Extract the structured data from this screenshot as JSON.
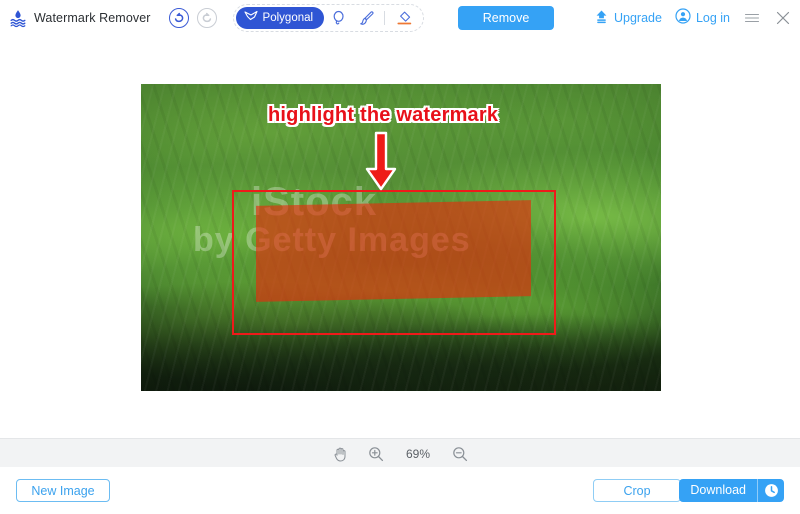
{
  "header": {
    "brand_title": "Watermark Remover",
    "logo_icon": "watermark-droplet-icon",
    "undo_icon": "undo-arrow-icon",
    "redo_icon": "redo-arrow-icon",
    "tools": {
      "active_label": "Polygonal",
      "active_icon": "polygonal-lasso-icon",
      "items": [
        {
          "name": "lasso",
          "icon": "lasso-icon"
        },
        {
          "name": "brush",
          "icon": "brush-icon"
        },
        {
          "name": "eraser",
          "icon": "eraser-icon"
        }
      ]
    },
    "remove_label": "Remove",
    "upgrade_label": "Upgrade",
    "upgrade_icon": "upgrade-arrow-icon",
    "login_label": "Log in",
    "login_icon": "user-avatar-icon",
    "menu_icon": "hamburger-menu-icon",
    "close_icon": "close-icon"
  },
  "canvas": {
    "annotation_text": "highlight the watermark",
    "annotation_arrow_icon": "down-arrow-annotation-icon",
    "watermark_line1": "iStock",
    "watermark_line2": "by Getty Images",
    "selection_color": "#ef1a1a",
    "mask_color": "#ea280c",
    "annotation_color": "#e8111a"
  },
  "zoombar": {
    "hand_icon": "hand-pan-icon",
    "zoom_in_icon": "zoom-in-icon",
    "zoom_out_icon": "zoom-out-icon",
    "zoom_level": "69%"
  },
  "footer": {
    "new_image_label": "New Image",
    "crop_label": "Crop",
    "download_label": "Download",
    "download_history_icon": "clock-history-icon"
  },
  "colors": {
    "primary_blue": "#35a2f5",
    "tool_blue": "#2f55d4",
    "border_gray": "#e4e6e8",
    "bar_gray": "#f2f3f4"
  }
}
